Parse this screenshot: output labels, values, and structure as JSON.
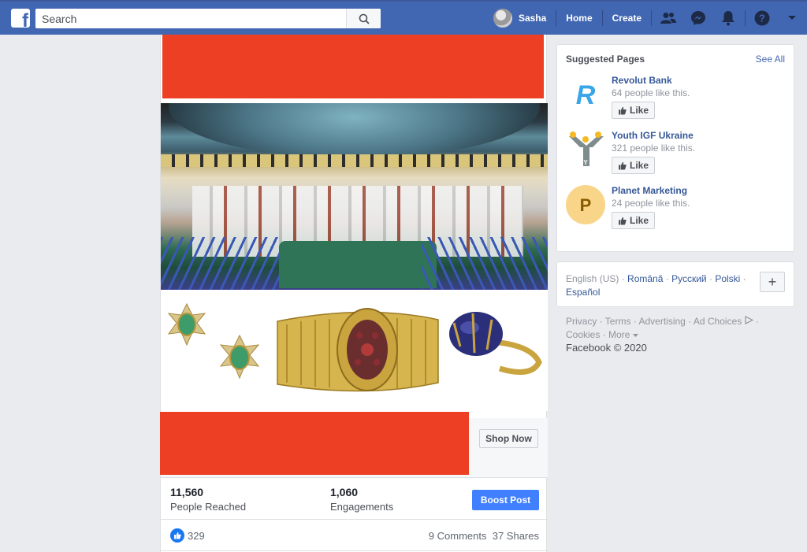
{
  "topbar": {
    "logo_letter": "f",
    "search_placeholder": "Search",
    "profile_name": "Sasha",
    "home": "Home",
    "create": "Create"
  },
  "ad": {
    "shop_now": "Shop Now"
  },
  "stats": {
    "reached_value": "11,560",
    "reached_label": "People Reached",
    "engagements_value": "1,060",
    "engagements_label": "Engagements",
    "boost_label": "Boost Post"
  },
  "reactions": {
    "likes": "329",
    "comments": "9 Comments",
    "shares": "37 Shares"
  },
  "suggested": {
    "title": "Suggested Pages",
    "see_all": "See All",
    "pages": [
      {
        "name": "Revolut Bank",
        "likes": "64 people like this.",
        "like_label": "Like",
        "logo_letter": "R"
      },
      {
        "name": "Youth IGF Ukraine",
        "likes": "321 people like this.",
        "like_label": "Like",
        "logo_letter": "Y"
      },
      {
        "name": "Planet Marketing",
        "likes": "24 people like this.",
        "like_label": "Like",
        "logo_letter": "P"
      }
    ]
  },
  "languages": {
    "current": "English (US)",
    "sep": "·",
    "options": [
      "Română",
      "Русский",
      "Polski",
      "Español"
    ],
    "plus": "+"
  },
  "footer": {
    "links": [
      "Privacy",
      "Terms",
      "Advertising",
      "Ad Choices",
      "Cookies",
      "More"
    ],
    "copyright": "Facebook © 2020"
  },
  "colors": {
    "brand": "#4267b2",
    "boost": "#4080ff",
    "redaction": "#ec3f23"
  },
  "icons": {
    "search": "search-icon",
    "friends": "friends-icon",
    "messenger": "messenger-icon",
    "notifications": "bell-icon",
    "help": "help-icon",
    "account_menu": "caret-down-icon"
  }
}
